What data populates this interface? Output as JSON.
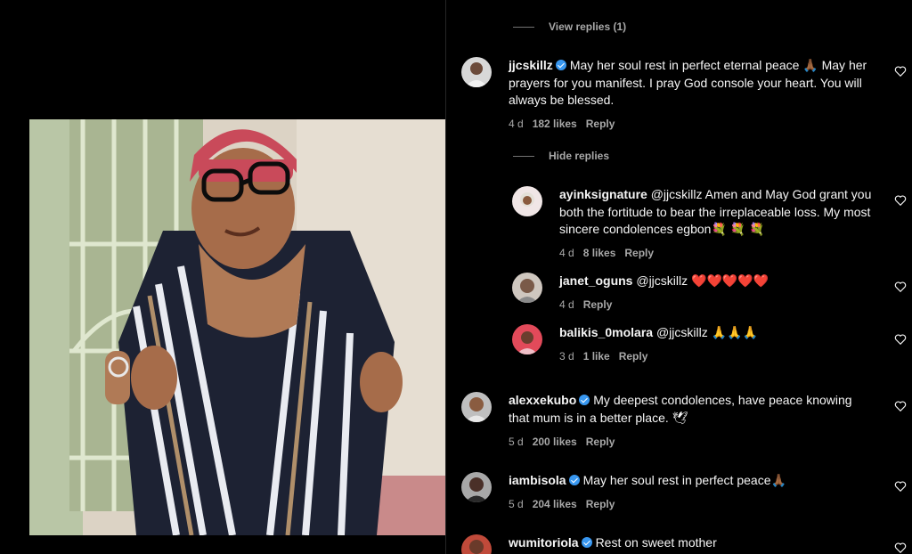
{
  "comments": {
    "view_replies_label": "View replies (1)",
    "hide_replies_label": "Hide replies",
    "reply_label": "Reply",
    "items": [
      {
        "user": "jjcskillz",
        "verified": true,
        "text": "May her soul rest in perfect eternal peace 🙏🏾 May her prayers for you manifest. I pray God console your heart. You will always be blessed.",
        "age": "4 d",
        "likes": "182 likes"
      },
      {
        "user": "ayinksignature",
        "verified": false,
        "text": "@jjcskillz Amen and May God grant you both the fortitude to bear the irreplaceable loss. My most sincere condolences egbon💐 💐 💐",
        "age": "4 d",
        "likes": "8 likes"
      },
      {
        "user": "janet_oguns",
        "verified": false,
        "text": "@jjcskillz ❤️❤️❤️❤️❤️",
        "age": "4 d",
        "likes": ""
      },
      {
        "user": "balikis_0molara",
        "verified": false,
        "text": "@jjcskillz 🙏🙏🙏",
        "age": "3 d",
        "likes": "1 like"
      },
      {
        "user": "alexxekubo",
        "verified": true,
        "text": "My deepest condolences, have peace knowing that mum is in a better place. 🕊",
        "age": "5 d",
        "likes": "200 likes"
      },
      {
        "user": "iambisola",
        "verified": true,
        "text": "May her soul rest in perfect peace🙏🏾",
        "age": "5 d",
        "likes": "204 likes"
      },
      {
        "user": "wumitoriola",
        "verified": true,
        "text": "Rest on sweet mother",
        "age": "",
        "likes": ""
      }
    ]
  },
  "colors": {
    "background": "#000000",
    "text": "#f5f5f5",
    "muted": "#a8a8a8",
    "verified": "#3897f0"
  }
}
